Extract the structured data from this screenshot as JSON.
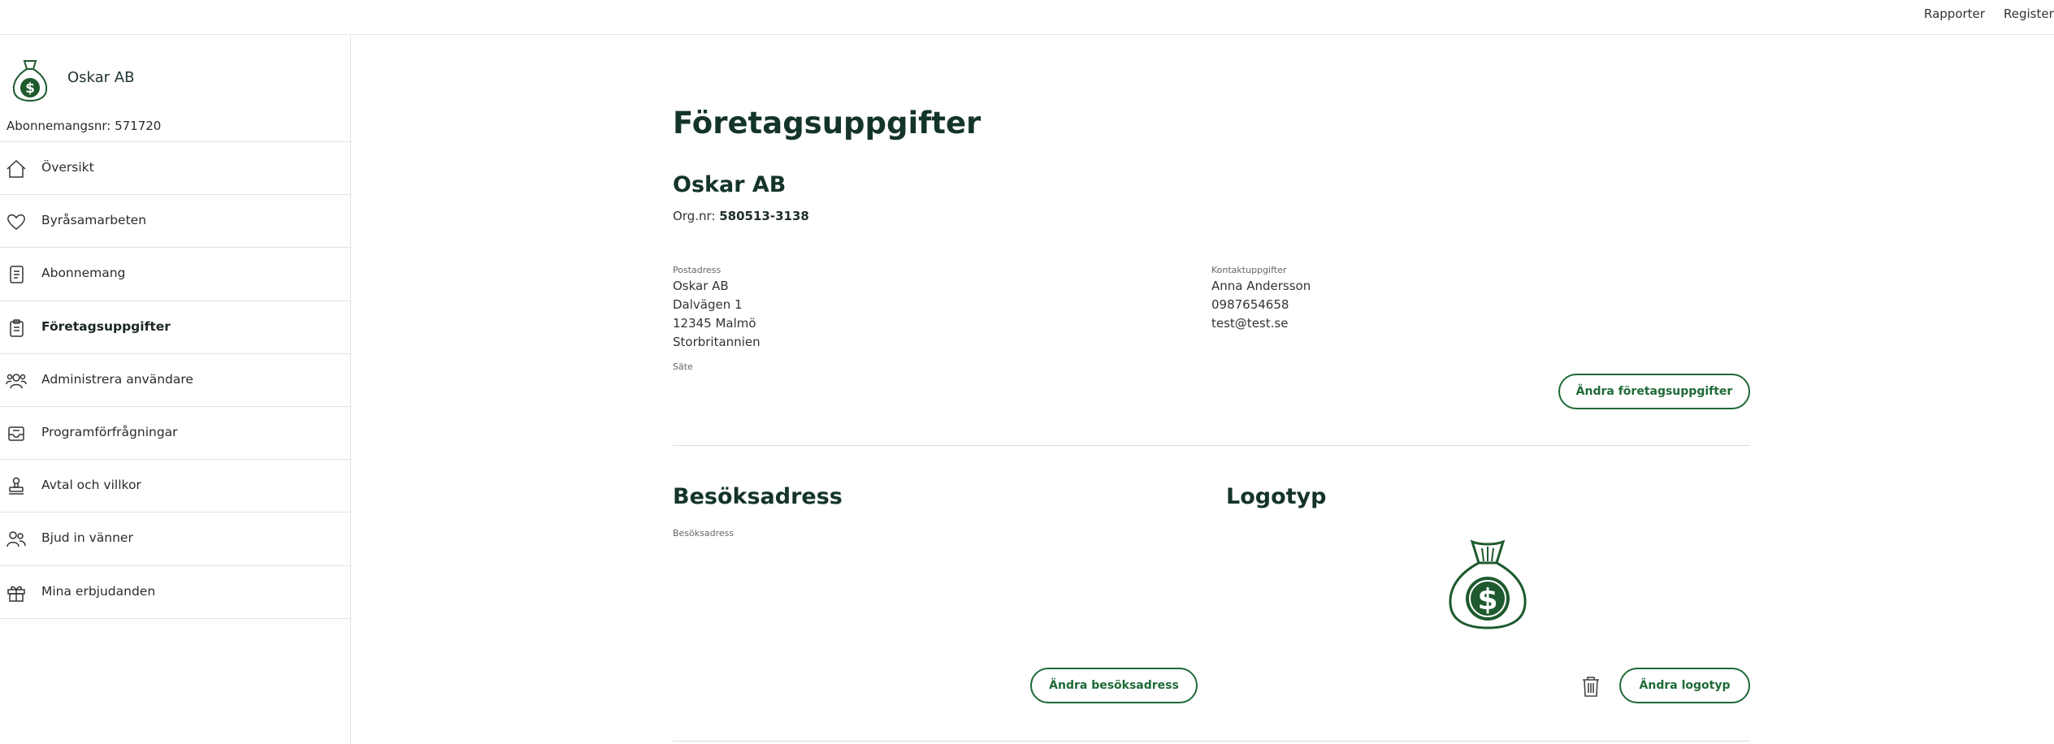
{
  "topnav": {
    "rapporter": "Rapporter",
    "register": "Register"
  },
  "company": {
    "name": "Oskar AB",
    "subscription": "Abonnemangsnr: 571720"
  },
  "nav": [
    {
      "label": "Översikt",
      "icon": "home-icon"
    },
    {
      "label": "Byråsamarbeten",
      "icon": "heart-icon"
    },
    {
      "label": "Abonnemang",
      "icon": "document-icon"
    },
    {
      "label": "Företagsuppgifter",
      "icon": "clipboard-icon",
      "active": true
    },
    {
      "label": "Administrera användare",
      "icon": "users-icon"
    },
    {
      "label": "Programförfrågningar",
      "icon": "inbox-icon"
    },
    {
      "label": "Avtal och villkor",
      "icon": "stamp-icon"
    },
    {
      "label": "Bjud in vänner",
      "icon": "people-icon"
    },
    {
      "label": "Mina erbjudanden",
      "icon": "gift-icon"
    }
  ],
  "main": {
    "title": "Företagsuppgifter",
    "company_name": "Oskar AB",
    "orgnr_label": "Org.nr: ",
    "orgnr_value": "580513-3138",
    "postal": {
      "label": "Postadress",
      "lines": [
        "Oskar AB",
        "Dalvägen 1",
        "12345 Malmö",
        "Storbritannien"
      ]
    },
    "seat_label": "Säte",
    "contact": {
      "label": "Kontaktuppgifter",
      "lines": [
        "Anna Andersson",
        "0987654658",
        "test@test.se"
      ]
    },
    "edit_company_button": "Ändra företagsuppgifter",
    "visit": {
      "title": "Besöksadress",
      "label": "Besöksadress",
      "button": "Ändra besöksadress"
    },
    "logo": {
      "title": "Logotyp",
      "button": "Ändra logotyp"
    }
  },
  "colors": {
    "accent": "#1e6a36",
    "heading": "#14342b"
  }
}
